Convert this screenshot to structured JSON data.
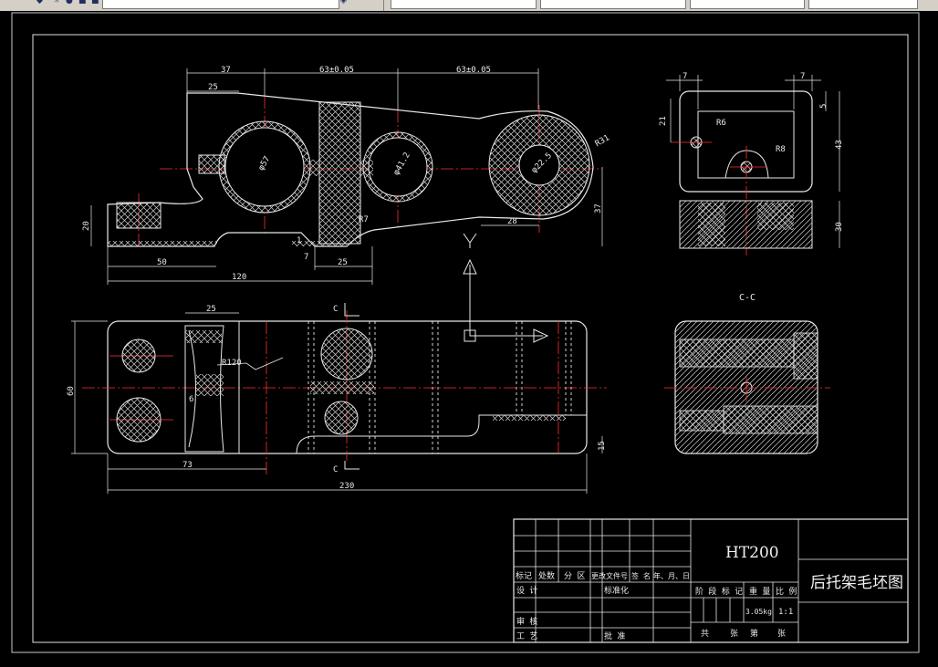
{
  "window": {
    "toolbar_icons": [
      "layer-icon",
      "sun-icon",
      "lightbulb-icon",
      "lock-icon",
      "color-square-icon",
      "dropdown-icon",
      "layer-state-icon",
      "dropdown-icon",
      "dropdown-icon"
    ]
  },
  "drawing": {
    "top_view_dims": {
      "d_37": "37",
      "d_63a": "63±0.05",
      "d_63b": "63±0.05",
      "d_25": "25",
      "d_20": "20",
      "d_50": "50",
      "d_120": "120",
      "d_25b": "25",
      "d_28": "28",
      "d_37v": "37",
      "d_1": "1",
      "d_7": "7",
      "r7": "R7",
      "phi57": "φ57",
      "phi41": "φ41.2",
      "phi22": "φ22.5",
      "r31": "R31"
    },
    "side_view_dims": {
      "d_7a": "7",
      "d_7b": "7",
      "d_21": "21",
      "d_5": "5",
      "d_43": "43",
      "d_30": "30",
      "r6": "R6",
      "r8": "R8"
    },
    "front_view_dims": {
      "d_25": "25",
      "d_60": "60",
      "r120": "R120",
      "d_6": "6",
      "d_73": "73",
      "d_230": "230",
      "d_15": "15",
      "section_mark_top": "C",
      "section_mark_bottom": "C"
    },
    "section_label": "C-C"
  },
  "title_block": {
    "material": "HT200",
    "drawing_name": "后托架毛坯图",
    "row_labels": {
      "mark": "标记",
      "count": "处数",
      "zone": "分 区",
      "change_doc": "更改文件号",
      "signature": "签 名",
      "date": "年、月、日",
      "design": "设 计",
      "standardize": "标准化",
      "review": "审 核",
      "process": "工 艺",
      "approve": "批 准"
    },
    "stage_mark": "阶 段 标 记",
    "weight_label": "重 量",
    "scale_label": "比 例",
    "weight_value": "3.05kg",
    "scale_value": "1:1",
    "total": "共",
    "sheets": "张",
    "sheet_no": "第",
    "sheet": "张"
  }
}
